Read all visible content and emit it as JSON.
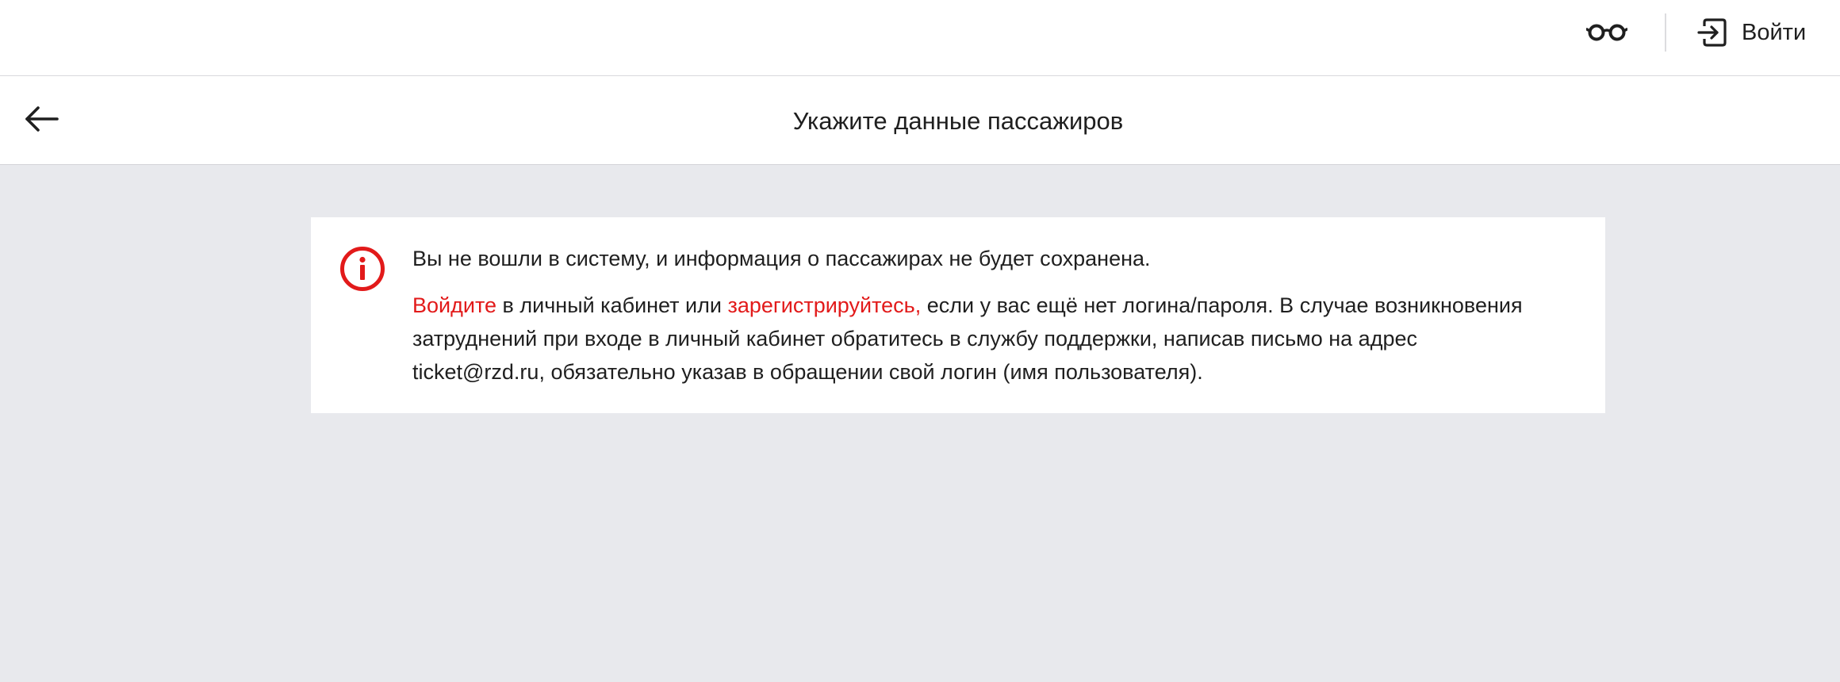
{
  "header": {
    "accessibility_icon": "glasses-icon",
    "login_icon": "login-icon",
    "login_label": "Войти"
  },
  "titlebar": {
    "back_icon": "arrow-left-icon",
    "title": "Укажите данные пассажиров"
  },
  "notice": {
    "icon": "info-circle-icon",
    "accent_color": "#e21a1a",
    "line1": "Вы не вошли в систему, и информация о пассажирах не будет сохранена.",
    "login_link": "Войдите",
    "text_after_login": " в личный кабинет или ",
    "register_link": "зарегистрируйтесь,",
    "text_after_register": " если у вас ещё нет логина/пароля. В случае возникновения",
    "line3": "затруднений при входе в личный кабинет обратитесь в службу поддержки, написав письмо на адрес",
    "line4": "ticket@rzd.ru, обязательно указав в обращении свой логин (имя пользователя)."
  }
}
